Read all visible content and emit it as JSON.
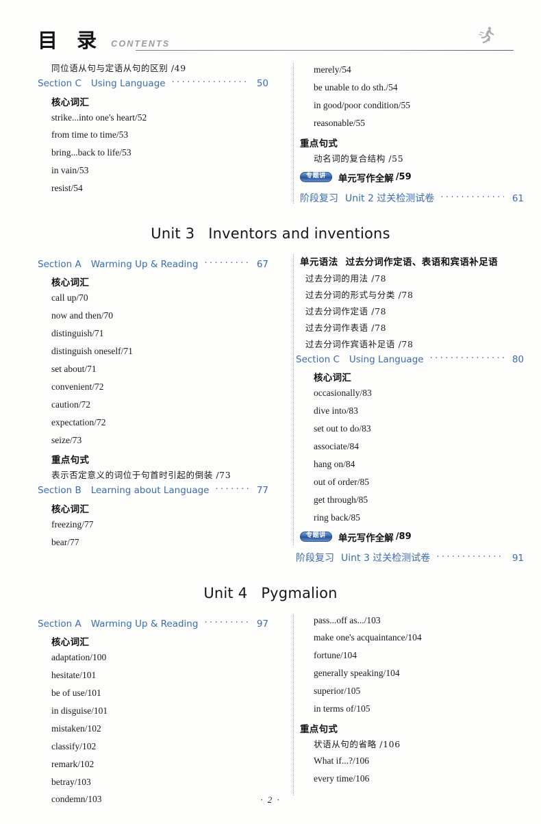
{
  "header": {
    "title_cn": "目 录",
    "title_en": "CONTENTS",
    "icon": "running-figure-icon"
  },
  "colors": {
    "accent_blue": "#3c6cb0",
    "text_black": "#1a1a1a",
    "rule_gray": "#7d7d7d"
  },
  "top_section": {
    "left": {
      "lead_entry": "同位语从句与定语从句的区别 /49",
      "section": {
        "label": "Section C",
        "title": "Using Language",
        "page": "50"
      },
      "vocab_heading": "核心词汇",
      "vocab": [
        "strike...into one's heart/52",
        "from time to time/53",
        "bring...back to life/53",
        "in vain/53",
        "resist/54"
      ]
    },
    "right": {
      "vocab_cont": [
        "merely/54",
        "be unable to do sth./54",
        "in good/poor condition/55",
        "reasonable/55"
      ],
      "sentence_heading": "重点句式",
      "sentences": [
        "动名词的复合结构 /55"
      ],
      "writing": {
        "badge": "专题讲",
        "label": "单元写作全解",
        "page": "/59"
      },
      "review": {
        "label": "阶段复习",
        "title": "Unit 2 过关检测试卷",
        "page": "61"
      }
    }
  },
  "unit3": {
    "title_unit": "Unit 3",
    "title_name": "Inventors and inventions",
    "left": {
      "section_a": {
        "label": "Section A",
        "title": "Warming Up & Reading",
        "page": "67"
      },
      "vocab_heading": "核心词汇",
      "vocab": [
        "call up/70",
        "now and then/70",
        "distinguish/71",
        "distinguish oneself/71",
        "set about/71",
        "convenient/72",
        "caution/72",
        "expectation/72",
        "seize/73"
      ],
      "sentence_heading": "重点句式",
      "sentences": [
        "表示否定意义的词位于句首时引起的倒装 /73"
      ],
      "section_b": {
        "label": "Section B",
        "title": "Learning about Language",
        "page": "77"
      },
      "vocab_heading_b": "核心词汇",
      "vocab_b": [
        "freezing/77",
        "bear/77"
      ]
    },
    "right": {
      "grammar_label": "单元语法",
      "grammar_title": "过去分词作定语、表语和宾语补足语",
      "grammar_items": [
        "过去分词的用法 /78",
        "过去分词的形式与分类 /78",
        "过去分词作定语 /78",
        "过去分词作表语 /78",
        "过去分词作宾语补足语 /78"
      ],
      "section_c": {
        "label": "Section C",
        "title": "Using Language",
        "page": "80"
      },
      "vocab_heading": "核心词汇",
      "vocab": [
        "occasionally/83",
        "dive into/83",
        "set out to do/83",
        "associate/84",
        "hang on/84",
        "out of order/85",
        "get through/85",
        "ring back/85"
      ],
      "writing": {
        "badge": "专题讲",
        "label": "单元写作全解",
        "page": "/89"
      },
      "review": {
        "label": "阶段复习",
        "title": "Uint 3 过关检测试卷",
        "page": "91"
      }
    }
  },
  "unit4": {
    "title_unit": "Unit 4",
    "title_name": "Pygmalion",
    "left": {
      "section_a": {
        "label": "Section A",
        "title": "Warming Up & Reading",
        "page": "97"
      },
      "vocab_heading": "核心词汇",
      "vocab": [
        "adaptation/100",
        "hesitate/101",
        "be of use/101",
        "in disguise/101",
        "mistaken/102",
        "classify/102",
        "remark/102",
        "betray/103",
        "condemn/103"
      ]
    },
    "right": {
      "vocab_cont": [
        "pass...off as.../103",
        "make one's acquaintance/104",
        "fortune/104",
        "generally speaking/104",
        "superior/105",
        "in terms of/105"
      ],
      "sentence_heading": "重点句式",
      "sentences": [
        "状语从句的省略 /106",
        "What if...?/106",
        "every time/106"
      ]
    }
  },
  "footer": {
    "page_number": "· 2 ·"
  },
  "leader_dots": "··········································································"
}
